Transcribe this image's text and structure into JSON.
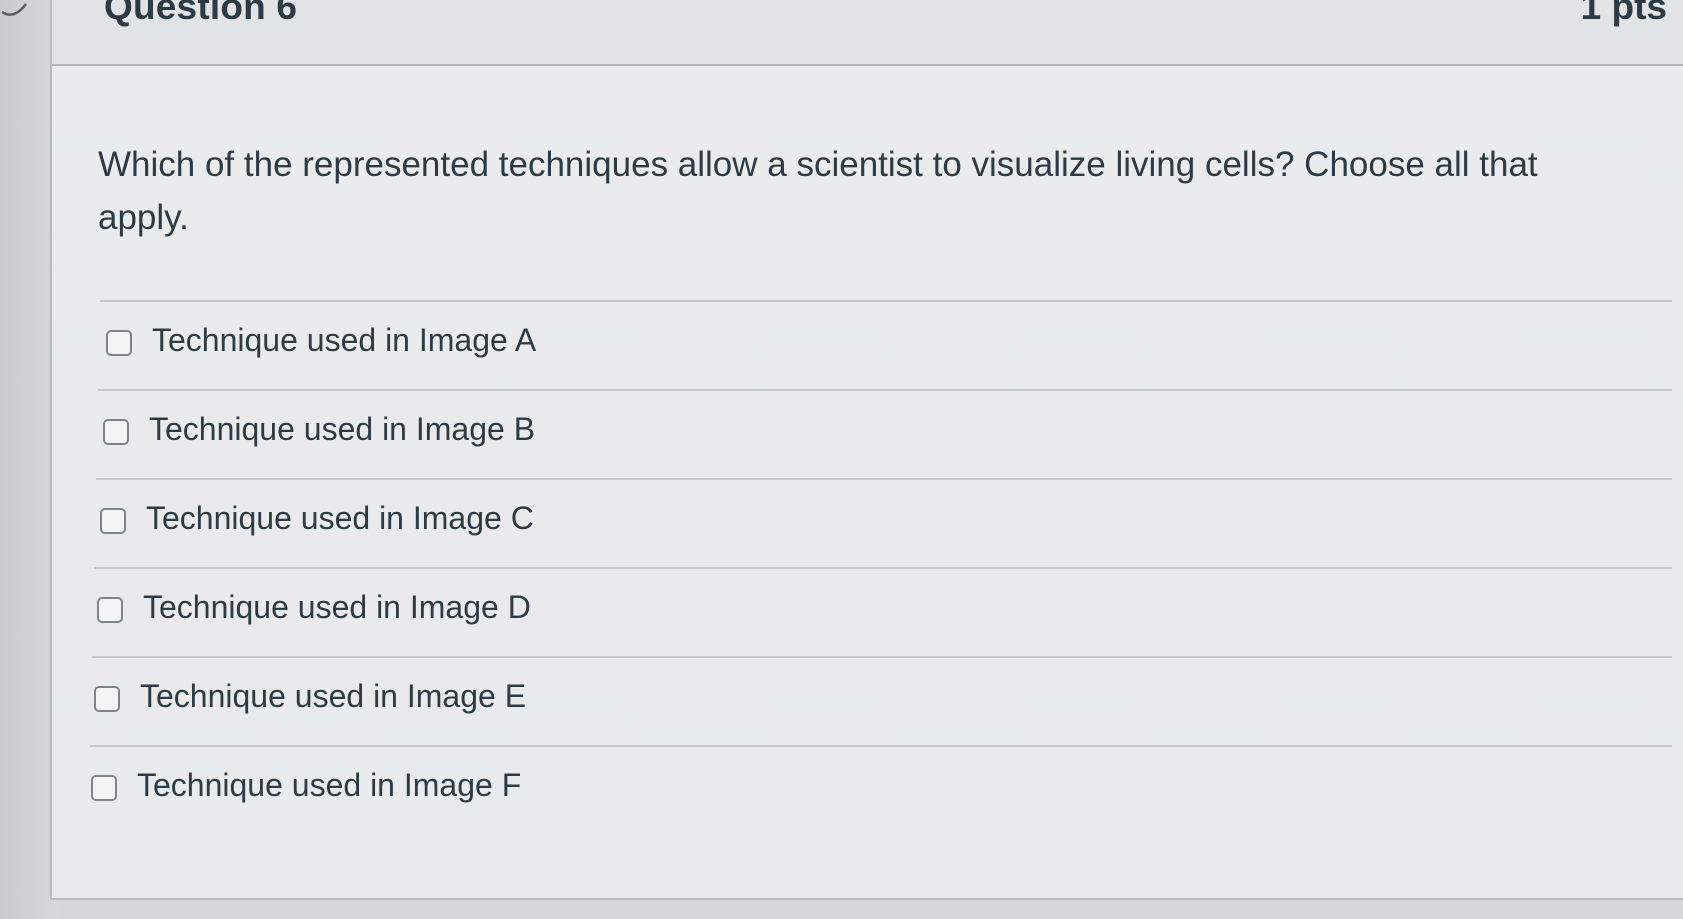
{
  "question": {
    "title": "Question 6",
    "points": "1 pts",
    "text": "Which of the represented techniques allow a scientist to visualize living cells?  Choose all that apply."
  },
  "answers": [
    {
      "label": "Technique used in Image A",
      "checked": false
    },
    {
      "label": "Technique used in Image B",
      "checked": false
    },
    {
      "label": "Technique used in Image C",
      "checked": false
    },
    {
      "label": "Technique used in Image D",
      "checked": false
    },
    {
      "label": "Technique used in Image E",
      "checked": false
    },
    {
      "label": "Technique used in Image F",
      "checked": false
    }
  ],
  "icons": {
    "collapse": "chevron-icon"
  }
}
